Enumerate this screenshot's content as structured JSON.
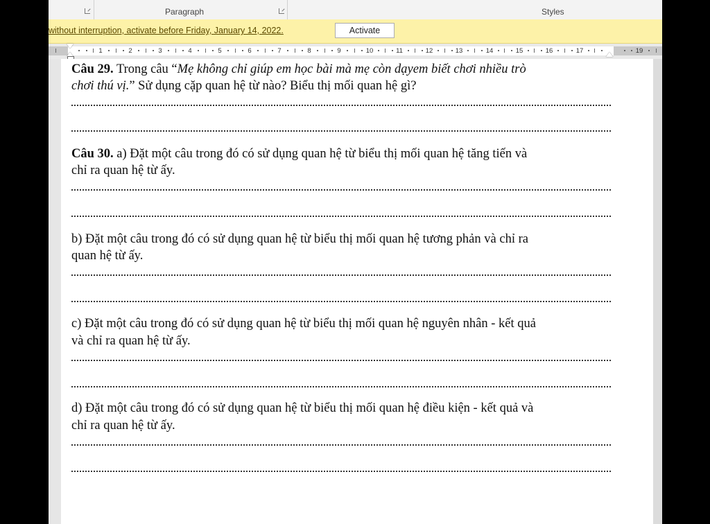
{
  "ribbon": {
    "paragraph_label": "Paragraph",
    "styles_label": "Styles"
  },
  "message_bar": {
    "text": "without interruption, activate before Friday, January 14, 2022.",
    "button_label": "Activate"
  },
  "ruler": {
    "numbers": [
      "1",
      "2",
      "3",
      "4",
      "5",
      "6",
      "7",
      "8",
      "9",
      "10",
      "11",
      "12",
      "13",
      "14",
      "15",
      "16",
      "17",
      "19"
    ]
  },
  "document": {
    "q29": {
      "label": "Câu 29.",
      "text_before": " Trong câu “",
      "quote_line1": "Mẹ không chỉ giúp em học bài mà mẹ còn dạyem biết chơi nhiều trò",
      "quote_line2": "chơi thú vị.",
      "text_after": "” Sử dụng cặp quan hệ từ nào? Biểu thị mối quan hệ gì?"
    },
    "q30": {
      "label": "Câu 30.",
      "a_line1": " a) Đặt một câu trong đó có sử dụng quan hệ từ biểu thị mối quan hệ tăng tiến và",
      "a_line2": "chỉ ra quan hệ từ ấy.",
      "b_line1": "b) Đặt một câu trong đó có sử dụng quan hệ từ biểu thị mối quan hệ tương phản và chỉ ra",
      "b_line2": "quan hệ từ ấy.",
      "c_line1": "c) Đặt một câu trong đó có sử dụng quan hệ từ biểu thị mối quan hệ nguyên nhân - kết quả",
      "c_line2": "và chỉ ra quan hệ từ ấy.",
      "d_line1": "d) Đặt một câu trong đó có sử dụng quan hệ từ biểu thị mối quan hệ điều kiện - kết quả và",
      "d_line2": "chỉ ra quan hệ từ ấy."
    }
  }
}
